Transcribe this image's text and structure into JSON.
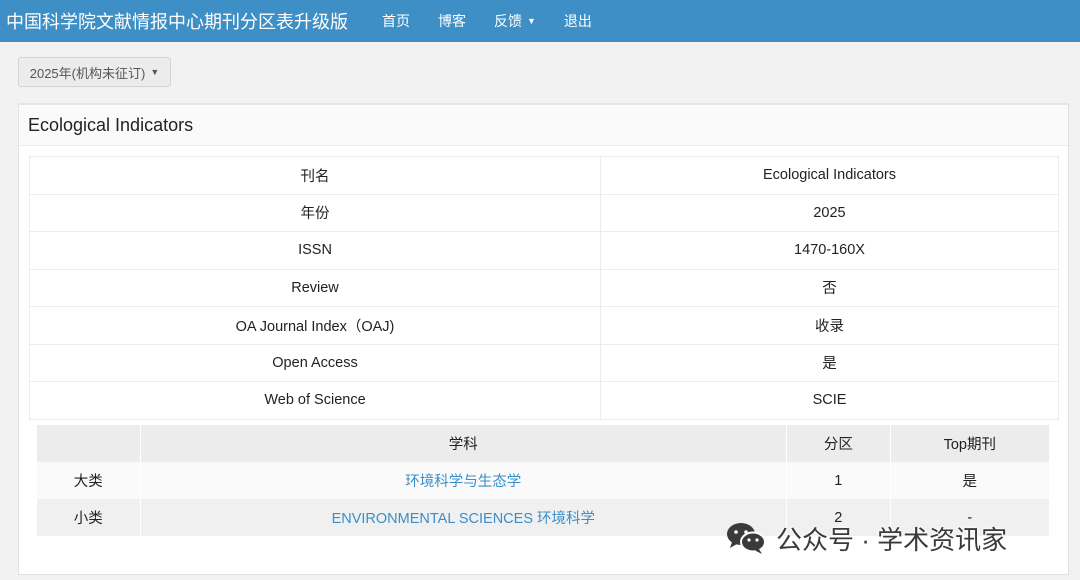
{
  "navbar": {
    "brand": "中国科学院文献情报中心期刊分区表升级版",
    "items": [
      {
        "label": "首页"
      },
      {
        "label": "博客"
      },
      {
        "label": "反馈",
        "has_dropdown": true
      },
      {
        "label": "退出"
      }
    ]
  },
  "year_selector": {
    "label": "2025年(机构未征订)"
  },
  "panel": {
    "title": "Ecological Indicators",
    "info_rows": [
      {
        "key": "刊名",
        "value": "Ecological Indicators"
      },
      {
        "key": "年份",
        "value": "2025"
      },
      {
        "key": "ISSN",
        "value": "1470-160X"
      },
      {
        "key": "Review",
        "value": "否"
      },
      {
        "key": "OA Journal Index（OAJ)",
        "value": "收录"
      },
      {
        "key": "Open Access",
        "value": "是"
      },
      {
        "key": "Web of Science",
        "value": "SCIE"
      }
    ],
    "subject_table": {
      "headers": [
        "",
        "学科",
        "分区",
        "Top期刊"
      ],
      "rows": [
        {
          "category": "大类",
          "subject": "环境科学与生态学",
          "zone": "1",
          "top": "是"
        },
        {
          "category": "小类",
          "subject": "ENVIRONMENTAL SCIENCES 环境科学",
          "zone": "2",
          "top": "-"
        }
      ]
    }
  },
  "watermark": {
    "text": "公众号 · 学术资讯家",
    "icon": "wechat-icon"
  },
  "colors": {
    "navbar": "#3d8fc6",
    "link": "#3a8fc9"
  }
}
